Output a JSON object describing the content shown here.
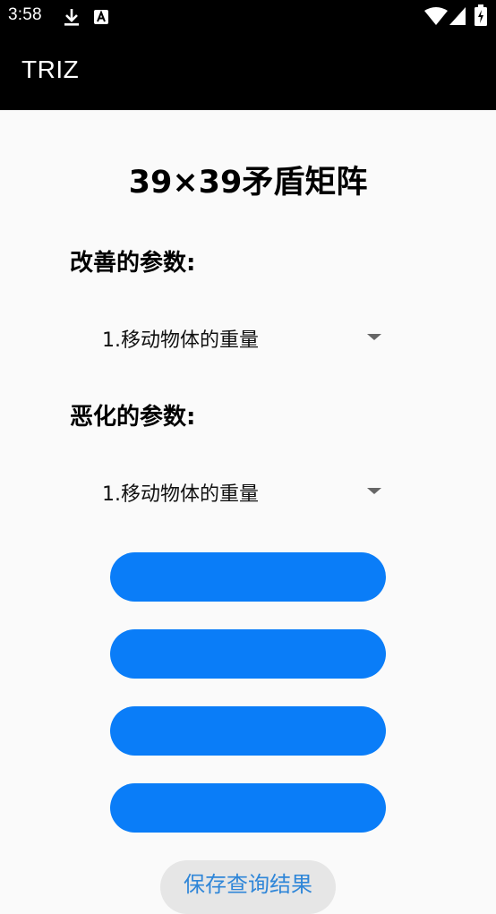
{
  "status_bar": {
    "time": "3:58",
    "icons": [
      "download-icon",
      "text-a-icon",
      "wifi-icon",
      "signal-icon",
      "battery-icon"
    ]
  },
  "app_bar": {
    "title": "TRIZ"
  },
  "main": {
    "title": "39×39矛盾矩阵",
    "improving_label": "改善的参数:",
    "improving_selected": "1.移动物体的重量",
    "worsening_label": "恶化的参数:",
    "worsening_selected": "1.移动物体的重量",
    "buttons": [
      "",
      "",
      "",
      ""
    ],
    "save_button_label": "保存查询结果"
  },
  "colors": {
    "primary_button": "#0a7df8",
    "app_bar": "#000000",
    "background": "#fafafa",
    "save_text": "#2f86d8"
  }
}
